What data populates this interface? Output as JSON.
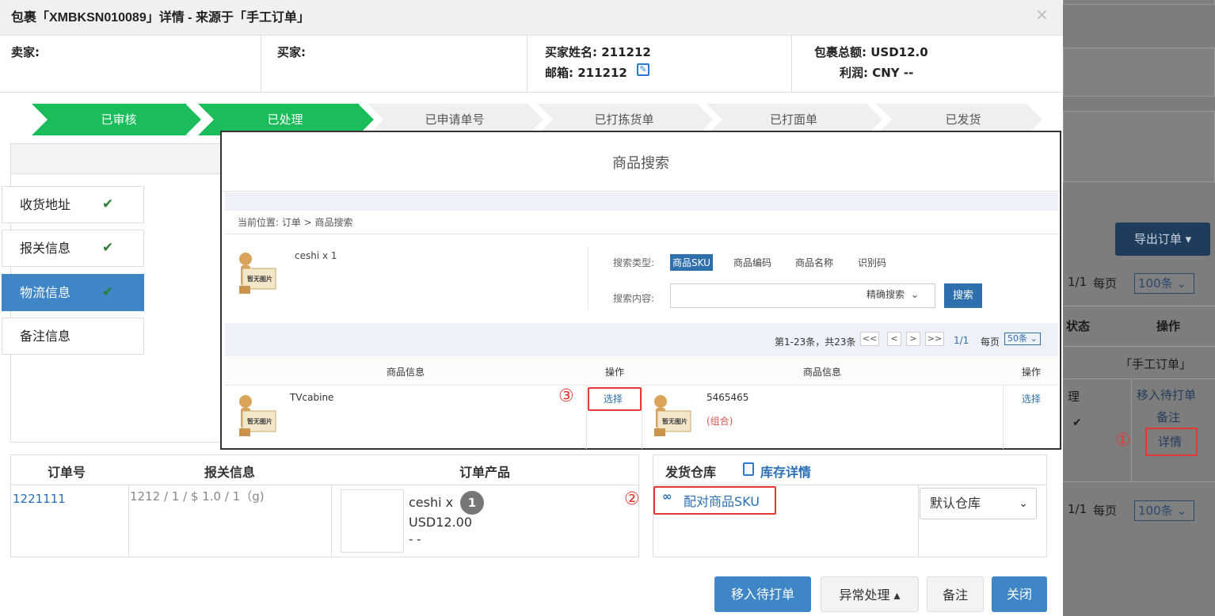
{
  "modal": {
    "title": "包裹「XMBKSN010089」详情 - 来源于「手工订单」",
    "close": "×",
    "seller_label": "卖家:",
    "buyer_label": "买家:",
    "buyer_name_label": "买家姓名:",
    "buyer_name": "211212",
    "email_label": "邮箱:",
    "email": "211212",
    "total_label": "包裹总额:",
    "total": "USD12.0",
    "profit_label": "利润:",
    "profit": "CNY --"
  },
  "steps": [
    {
      "label": "已审核",
      "done": true
    },
    {
      "label": "已处理",
      "done": true
    },
    {
      "label": "已申请单号",
      "done": false
    },
    {
      "label": "已打拣货单",
      "done": false
    },
    {
      "label": "已打面单",
      "done": false
    },
    {
      "label": "已发货",
      "done": false
    }
  ],
  "side_tabs": [
    {
      "label": "收货地址",
      "check": "✔"
    },
    {
      "label": "报关信息",
      "check": "✔"
    },
    {
      "label": "物流信息",
      "check": "✔"
    },
    {
      "label": "备注信息",
      "check": ""
    }
  ],
  "order_table": {
    "headers": [
      "订单号",
      "报关信息",
      "订单产品"
    ],
    "order_no": "1221111",
    "customs": "1212 / 1 / $ 1.0 / 1（g)",
    "product_name": "ceshi x",
    "qty": "1",
    "price": "USD12.00",
    "dash": "- -"
  },
  "warehouse": {
    "label": "发货仓库",
    "stock_link": "库存详情",
    "pair_sku": "配对商品SKU",
    "select": "默认仓库"
  },
  "footer_buttons": {
    "move": "移入待打单",
    "exception": "异常处理 ▴",
    "note": "备注",
    "close": "关闭"
  },
  "annotations": {
    "one": "①",
    "two": "②",
    "three": "③"
  },
  "popup": {
    "title": "商品搜索",
    "breadcrumb": "当前位置: 订单 > 商品搜索",
    "product": "ceshi x  1",
    "no_image": "暂无图片",
    "search_type_label": "搜索类型:",
    "search_types": [
      "商品SKU",
      "商品编码",
      "商品名称",
      "识别码"
    ],
    "search_content_label": "搜索内容:",
    "search_mode": "精确搜索",
    "search_button": "搜索",
    "paging_summary": "第1-23条，共23条",
    "paging_buttons": [
      "<<",
      "<",
      ">",
      ">>"
    ],
    "page": "1/1",
    "per_page_label": "每页",
    "per_page": "50条",
    "col_info": "商品信息",
    "col_action": "操作",
    "results": [
      {
        "name": "TVcabine",
        "sub": "",
        "action": "选择"
      },
      {
        "name": "5465465",
        "sub": "(组合)",
        "action": "选择"
      }
    ]
  },
  "background": {
    "export_btn": "导出订单 ▾",
    "pager": "1/1",
    "per_page_label": "每页",
    "per_page": "100条",
    "col_status": "状态",
    "col_action": "操作",
    "source": "「手工订单」",
    "status_partial": "理",
    "action_move": "移入待打单",
    "action_note": "备注",
    "action_detail": "详情",
    "pager2": "1/1",
    "per_page2": "100条"
  }
}
